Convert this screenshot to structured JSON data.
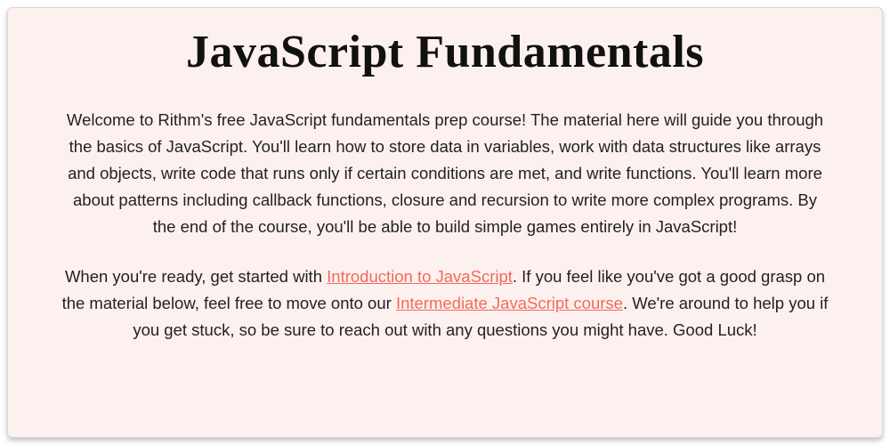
{
  "title": "JavaScript Fundamentals",
  "para1": "Welcome to Rithm's free JavaScript fundamentals prep course! The material here will guide you through the basics of JavaScript. You'll learn how to store data in variables, work with data structures like arrays and objects, write code that runs only if certain conditions are met, and write functions. You'll learn more about patterns including callback functions, closure and recursion to write more complex programs. By the end of the course, you'll be able to build simple games entirely in JavaScript!",
  "para2_a": "When you're ready, get started with ",
  "link1": "Introduction to JavaScript",
  "para2_b": ". If you feel like you've got a good grasp on the material below, feel free to move onto our ",
  "link2": "Intermediate JavaScript course",
  "para2_c": ". We're around to help you if you get stuck, so be sure to reach out with any questions you might have. Good Luck!"
}
